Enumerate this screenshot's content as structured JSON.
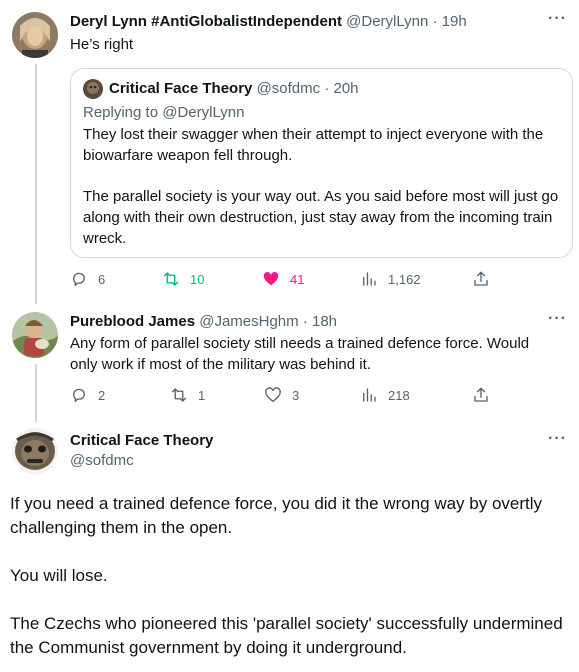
{
  "tweets": [
    {
      "name": "Deryl Lynn #AntiGlobalistIndependent",
      "handle": "@DerylLynn",
      "time": "· 19h",
      "text": "He’s right",
      "quote": {
        "name": "Critical Face Theory",
        "handle": "@sofdmc",
        "time": "· 20h",
        "replying": "Replying to @DerylLynn",
        "p1": "They lost their swagger when their attempt to inject everyone with the biowarfare weapon fell through.",
        "p2": "The parallel society is your way out. As you said before most will just go along with their own destruction, just stay away from the incoming train wreck."
      },
      "stats": {
        "replies": "6",
        "retweets": "10",
        "likes": "41",
        "views": "1,162"
      },
      "liked": true
    },
    {
      "name": "Pureblood James",
      "handle": "@JamesHghm",
      "time": "· 18h",
      "text": "Any form of parallel society still needs a trained defence force.  Would only work if most of the military was behind it.",
      "stats": {
        "replies": "2",
        "retweets": "1",
        "likes": "3",
        "views": "218"
      }
    },
    {
      "name": "Critical Face Theory",
      "handle": "@sofdmc",
      "paragraphs": [
        "If you need a trained defence force, you did it the wrong way by overtly challenging them in the open.",
        "You will lose.",
        "The Czechs who pioneered this 'parallel society' successfully undermined the Communist government by doing it underground."
      ]
    }
  ],
  "colors": {
    "retweet": "#00ba7c",
    "like": "#f91880",
    "muted": "#536471",
    "line": "#cfd9de"
  },
  "icons": [
    "reply-icon",
    "retweet-icon",
    "heart-icon",
    "views-icon",
    "share-icon",
    "more-icon"
  ]
}
